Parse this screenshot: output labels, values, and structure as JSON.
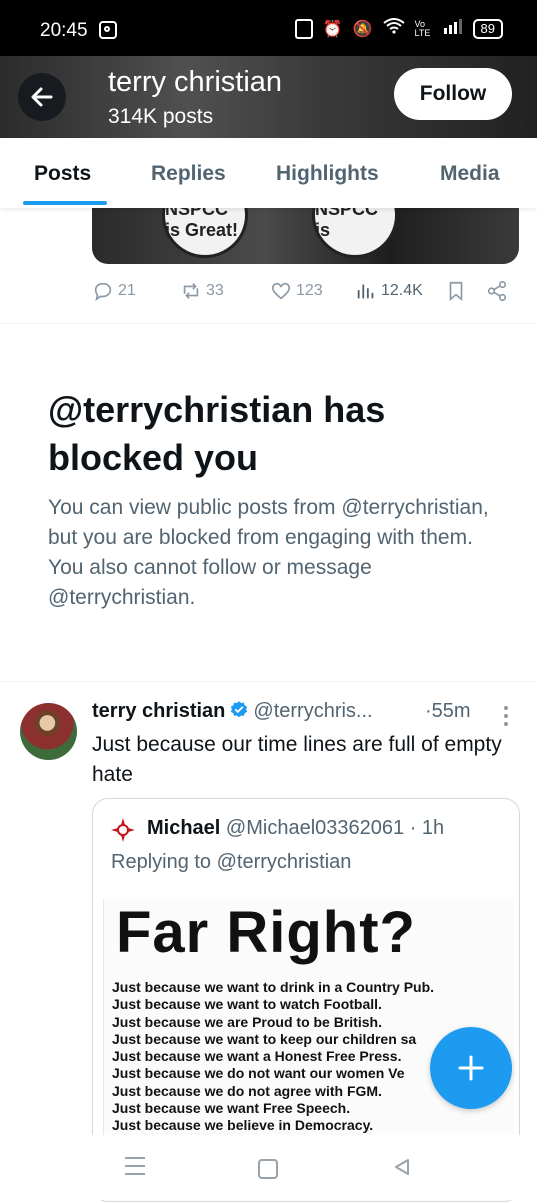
{
  "status_bar": {
    "time": "20:45",
    "battery": "89",
    "icons": [
      "instagram-icon",
      "nfc-icon",
      "alarm-icon",
      "mute-icon",
      "wifi-icon",
      "volte-icon",
      "signal-icon",
      "battery-icon"
    ],
    "volte": "Vo LTE"
  },
  "header": {
    "name": "terry christian",
    "posts": "314K posts",
    "follow_label": "Follow",
    "back_icon": "arrow-left-icon"
  },
  "tabs": [
    {
      "label": "Posts",
      "active": true
    },
    {
      "label": "Replies",
      "active": false
    },
    {
      "label": "Highlights",
      "active": false
    },
    {
      "label": "Media",
      "active": false
    }
  ],
  "prev_post": {
    "image_text": [
      "NSPCC is Great!",
      "NSPCC is"
    ],
    "actions": {
      "replies": "21",
      "reposts": "33",
      "likes": "123",
      "views": "12.4K"
    }
  },
  "blocked": {
    "title": "@terrychristian has blocked you",
    "body": "You can view public posts from @terrychristian, but you are blocked from engaging with them. You also cannot follow or message @terrychristian."
  },
  "tweet": {
    "name": "terry christian",
    "handle": "@terrychris...",
    "dot": "·",
    "time": "55m",
    "text": "Just because our time lines are full of empty hate",
    "quote": {
      "name": "Michael",
      "handle": "@Michael03362061",
      "time": "· 1h",
      "replying": "Replying to @terrychristian",
      "poster_title": "Far Right?",
      "poster_lines": [
        "Just because we want to drink in a Country Pub.",
        "Just because we want to watch Football.",
        "Just because we are Proud to be British.",
        "Just because we want to keep our children sa",
        "Just because we want a Honest Free Press.",
        "Just because we do not want our women Ve",
        "Just because we do not agree with FGM.",
        "Just because we want Free Speech.",
        "Just because we believe in Democracy."
      ]
    }
  },
  "colors": {
    "accent": "#1d9bf0",
    "text": "#0f1419",
    "secondary": "#536471"
  }
}
